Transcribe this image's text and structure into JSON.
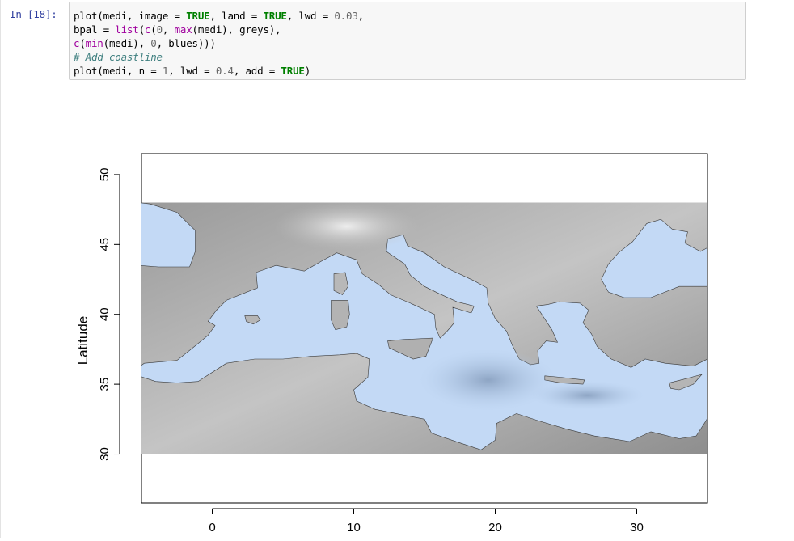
{
  "cell": {
    "prompt": "In [18]:",
    "code": {
      "line1": {
        "a": "plot(medi, image = ",
        "b": "TRUE",
        "c": ", land = ",
        "d": "TRUE",
        "e": ", lwd = ",
        "f": "0.03",
        "g": ","
      },
      "line2": {
        "a": "bpal = ",
        "b": "list",
        "c": "(",
        "d": "c",
        "e": "(",
        "f": "0",
        "g": ", ",
        "h": "max",
        "i": "(medi), greys),",
        "j": ""
      },
      "line3": {
        "a": "c",
        "b": "(",
        "c": "min",
        "d": "(medi), ",
        "e": "0",
        "f": ", blues)))"
      },
      "line4": {
        "comment": "# Add coastline"
      },
      "line5": {
        "a": "plot(medi, n = ",
        "b": "1",
        "c": ", lwd = ",
        "d": "0.4",
        "e": ", add = ",
        "f": "TRUE",
        "g": ")"
      }
    }
  },
  "chart_data": {
    "type": "heatmap",
    "title": "",
    "xlabel": "",
    "ylabel": "Latitude",
    "x_ticks": [
      0,
      10,
      20,
      30
    ],
    "y_ticks": [
      30,
      35,
      40,
      45,
      50
    ],
    "x_tick_labels": [
      "0",
      "10",
      "20",
      "30"
    ],
    "y_tick_labels": [
      "30",
      "35",
      "40",
      "45",
      "50"
    ],
    "xlim": [
      -5,
      35
    ],
    "ylim": [
      26.5,
      51.5
    ],
    "data_extent": {
      "lon": [
        -5,
        35
      ],
      "lat": [
        30,
        48
      ]
    },
    "palette": {
      "land": "greys",
      "sea": "blues"
    },
    "colors": {
      "land_low": "#8f8f8f",
      "land_high": "#e2e2e2",
      "sea": "#c3d9f5",
      "sea_deep": "#9db4d2",
      "coast": "#3a3a3a"
    },
    "grid": false,
    "legend": "none"
  }
}
